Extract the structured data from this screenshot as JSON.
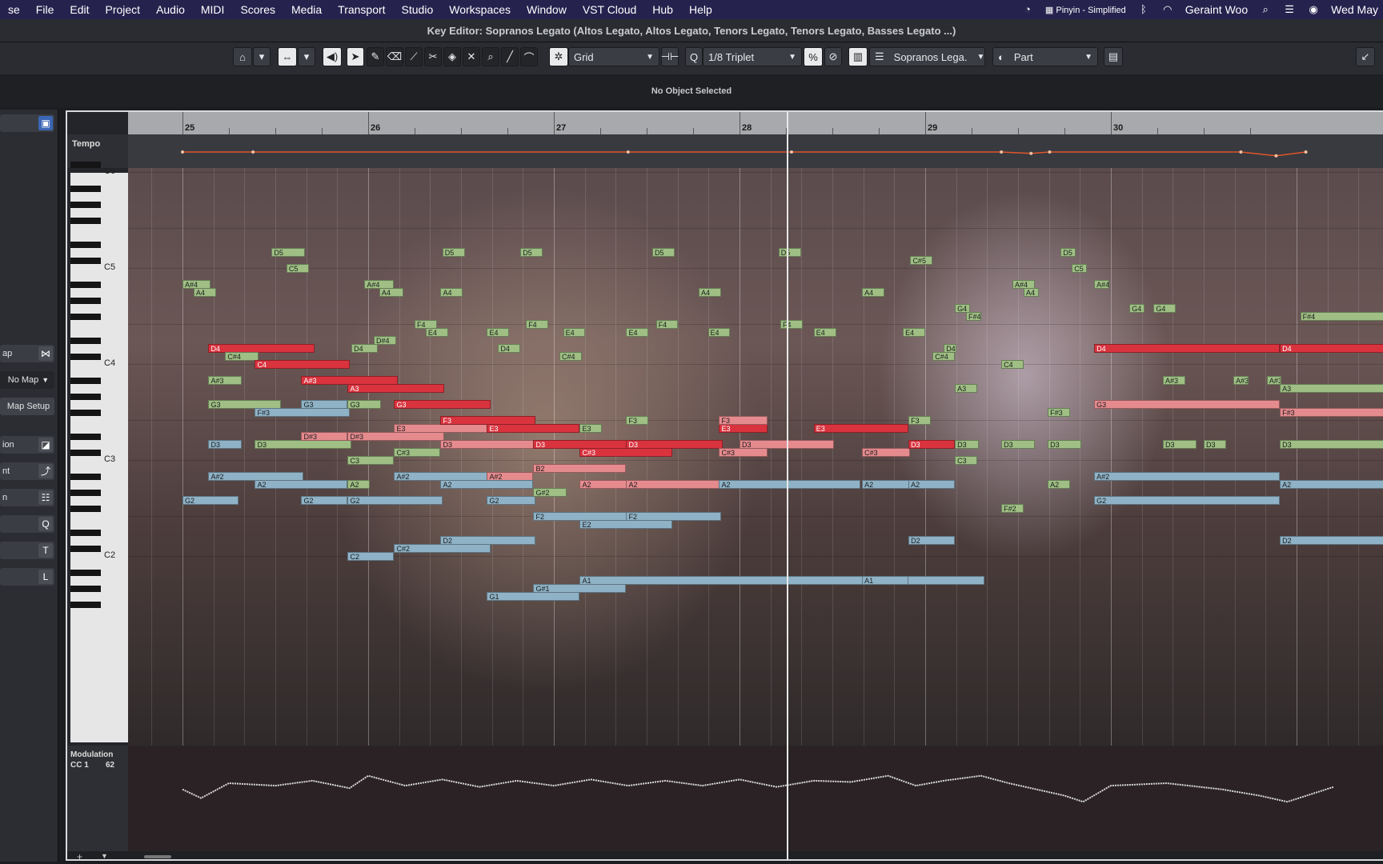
{
  "menubar": {
    "items": [
      "se",
      "File",
      "Edit",
      "Project",
      "Audio",
      "MIDI",
      "Scores",
      "Media",
      "Transport",
      "Studio",
      "Workspaces",
      "Window",
      "VST Cloud",
      "Hub",
      "Help"
    ],
    "input_method": "Pinyin - Simplified",
    "user": "Geraint Woo",
    "datetime": "Wed May"
  },
  "title": "Key Editor: Sopranos Legato (Altos Legato, Altos Legato, Tenors Legato, Tenors Legato, Basses Legato ...)",
  "toolbar": {
    "snap_type": "Grid",
    "quantize_prefix": "Q",
    "quantize": "1/8 Triplet",
    "track": "Sopranos Lega.",
    "part": "Part"
  },
  "info_line": "No Object Selected",
  "inspector": {
    "map_label": "ap",
    "no_map": "No Map",
    "map_setup": "Map Setup",
    "row1": "ion",
    "row2": "nt",
    "row3": "n"
  },
  "ruler": {
    "bars": [
      "25",
      "26",
      "27",
      "28",
      "29",
      "30"
    ]
  },
  "tempo_label": "Tempo",
  "keyboard": {
    "octave_labels": [
      "C6",
      "C5",
      "C4",
      "C3",
      "C2"
    ]
  },
  "controller_lane": {
    "name": "Modulation",
    "cc": "CC 1",
    "value": "62"
  },
  "notes": [
    {
      "p": "A#4",
      "s": 0.0,
      "l": 0.15,
      "c": "green"
    },
    {
      "p": "A4",
      "s": 0.06,
      "l": 0.12,
      "c": "green"
    },
    {
      "p": "D5",
      "s": 0.48,
      "l": 0.18,
      "c": "green"
    },
    {
      "p": "C5",
      "s": 0.56,
      "l": 0.12,
      "c": "green"
    },
    {
      "p": "D4",
      "s": 0.14,
      "l": 0.57,
      "c": "red"
    },
    {
      "p": "C#4",
      "s": 0.23,
      "l": 0.18,
      "c": "green"
    },
    {
      "p": "C4",
      "s": 0.39,
      "l": 0.51,
      "c": "red"
    },
    {
      "p": "A#3",
      "s": 0.14,
      "l": 0.18,
      "c": "green"
    },
    {
      "p": "G3",
      "s": 0.14,
      "l": 0.39,
      "c": "green"
    },
    {
      "p": "F#3",
      "s": 0.39,
      "l": 0.51,
      "c": "blue"
    },
    {
      "p": "D3",
      "s": 0.14,
      "l": 0.18,
      "c": "blue"
    },
    {
      "p": "D3",
      "s": 0.39,
      "l": 0.52,
      "c": "green"
    },
    {
      "p": "G2",
      "s": 0.0,
      "l": 0.3,
      "c": "blue"
    },
    {
      "p": "A#2",
      "s": 0.14,
      "l": 0.51,
      "c": "blue"
    },
    {
      "p": "A2",
      "s": 0.39,
      "l": 0.5,
      "c": "blue"
    },
    {
      "p": "D4",
      "s": 0.91,
      "l": 0.14,
      "c": "green"
    },
    {
      "p": "D#4",
      "s": 1.03,
      "l": 0.12,
      "c": "green"
    },
    {
      "p": "A#4",
      "s": 0.98,
      "l": 0.16,
      "c": "green"
    },
    {
      "p": "A4",
      "s": 1.06,
      "l": 0.13,
      "c": "green"
    },
    {
      "p": "F4",
      "s": 1.25,
      "l": 0.12,
      "c": "green"
    },
    {
      "p": "E4",
      "s": 1.31,
      "l": 0.12,
      "c": "green"
    },
    {
      "p": "A#3",
      "s": 0.64,
      "l": 0.52,
      "c": "red"
    },
    {
      "p": "A3",
      "s": 0.89,
      "l": 0.52,
      "c": "red"
    },
    {
      "p": "G3",
      "s": 0.64,
      "l": 0.25,
      "c": "blue"
    },
    {
      "p": "G3",
      "s": 0.89,
      "l": 0.18,
      "c": "green"
    },
    {
      "p": "D#3",
      "s": 0.64,
      "l": 0.25,
      "c": "pink"
    },
    {
      "p": "D#3",
      "s": 0.89,
      "l": 0.52,
      "c": "pink"
    },
    {
      "p": "C3",
      "s": 0.89,
      "l": 0.25,
      "c": "green"
    },
    {
      "p": "A2",
      "s": 0.89,
      "l": 0.12,
      "c": "green"
    },
    {
      "p": "G2",
      "s": 0.64,
      "l": 0.25,
      "c": "blue"
    },
    {
      "p": "G2",
      "s": 0.89,
      "l": 0.51,
      "c": "blue"
    },
    {
      "p": "C2",
      "s": 0.89,
      "l": 0.25,
      "c": "blue"
    },
    {
      "p": "C#2",
      "s": 1.14,
      "l": 0.52,
      "c": "blue"
    },
    {
      "p": "A#2",
      "s": 1.14,
      "l": 0.51,
      "c": "blue"
    },
    {
      "p": "C#3",
      "s": 1.14,
      "l": 0.25,
      "c": "green"
    },
    {
      "p": "E3",
      "s": 1.14,
      "l": 0.52,
      "c": "pink"
    },
    {
      "p": "G3",
      "s": 1.14,
      "l": 0.52,
      "c": "red"
    },
    {
      "p": "A4",
      "s": 1.39,
      "l": 0.12,
      "c": "green"
    },
    {
      "p": "D5",
      "s": 1.4,
      "l": 0.12,
      "c": "green"
    },
    {
      "p": "E4",
      "s": 1.64,
      "l": 0.12,
      "c": "green"
    },
    {
      "p": "D4",
      "s": 1.7,
      "l": 0.12,
      "c": "green"
    },
    {
      "p": "D5",
      "s": 1.82,
      "l": 0.12,
      "c": "green"
    },
    {
      "p": "F4",
      "s": 1.85,
      "l": 0.12,
      "c": "green"
    },
    {
      "p": "C#4",
      "s": 2.03,
      "l": 0.12,
      "c": "green"
    },
    {
      "p": "E4",
      "s": 2.05,
      "l": 0.12,
      "c": "green"
    },
    {
      "p": "F3",
      "s": 1.39,
      "l": 0.51,
      "c": "red"
    },
    {
      "p": "E3",
      "s": 1.64,
      "l": 0.5,
      "c": "red"
    },
    {
      "p": "D3",
      "s": 1.39,
      "l": 0.51,
      "c": "pink"
    },
    {
      "p": "D3",
      "s": 1.89,
      "l": 0.51,
      "c": "red"
    },
    {
      "p": "A#2",
      "s": 1.64,
      "l": 0.25,
      "c": "pink"
    },
    {
      "p": "A2",
      "s": 1.39,
      "l": 0.5,
      "c": "blue"
    },
    {
      "p": "G2",
      "s": 1.64,
      "l": 0.26,
      "c": "blue"
    },
    {
      "p": "G#2",
      "s": 1.89,
      "l": 0.18,
      "c": "green"
    },
    {
      "p": "B2",
      "s": 1.89,
      "l": 0.5,
      "c": "pink"
    },
    {
      "p": "F2",
      "s": 1.89,
      "l": 0.51,
      "c": "blue"
    },
    {
      "p": "D2",
      "s": 1.39,
      "l": 0.51,
      "c": "blue"
    },
    {
      "p": "G1",
      "s": 1.64,
      "l": 0.5,
      "c": "blue"
    },
    {
      "p": "G#1",
      "s": 1.89,
      "l": 0.5,
      "c": "blue"
    },
    {
      "p": "E3",
      "s": 2.14,
      "l": 0.12,
      "c": "green"
    },
    {
      "p": "C#3",
      "s": 2.14,
      "l": 0.5,
      "c": "red"
    },
    {
      "p": "A2",
      "s": 2.14,
      "l": 0.5,
      "c": "pink"
    },
    {
      "p": "E2",
      "s": 2.14,
      "l": 0.5,
      "c": "blue"
    },
    {
      "p": "A1",
      "s": 2.14,
      "l": 2.18,
      "c": "blue"
    },
    {
      "p": "F3",
      "s": 2.39,
      "l": 0.12,
      "c": "green"
    },
    {
      "p": "F2",
      "s": 2.39,
      "l": 0.51,
      "c": "blue"
    },
    {
      "p": "D3",
      "s": 2.39,
      "l": 0.52,
      "c": "red"
    },
    {
      "p": "A2",
      "s": 2.39,
      "l": 0.52,
      "c": "pink"
    },
    {
      "p": "E4",
      "s": 2.39,
      "l": 0.12,
      "c": "green"
    },
    {
      "p": "F4",
      "s": 2.55,
      "l": 0.12,
      "c": "green"
    },
    {
      "p": "D5",
      "s": 2.53,
      "l": 0.12,
      "c": "green"
    },
    {
      "p": "A4",
      "s": 2.78,
      "l": 0.12,
      "c": "green"
    },
    {
      "p": "E4",
      "s": 2.83,
      "l": 0.12,
      "c": "green"
    },
    {
      "p": "E3",
      "s": 2.89,
      "l": 0.26,
      "c": "red"
    },
    {
      "p": "C#3",
      "s": 2.89,
      "l": 0.26,
      "c": "pink"
    },
    {
      "p": "F3",
      "s": 2.89,
      "l": 0.26,
      "c": "pink"
    },
    {
      "p": "D3",
      "s": 3.0,
      "l": 0.51,
      "c": "pink"
    },
    {
      "p": "A2",
      "s": 2.89,
      "l": 0.76,
      "c": "blue"
    },
    {
      "p": "D5",
      "s": 3.21,
      "l": 0.12,
      "c": "green"
    },
    {
      "p": "F4",
      "s": 3.22,
      "l": 0.12,
      "c": "green"
    },
    {
      "p": "E4",
      "s": 3.4,
      "l": 0.12,
      "c": "green"
    },
    {
      "p": "E3",
      "s": 3.52,
      "l": 0.18,
      "c": "pink"
    },
    {
      "p": "E3",
      "s": 3.4,
      "l": 0.51,
      "c": "red"
    },
    {
      "p": "A4",
      "s": 3.66,
      "l": 0.12,
      "c": "green"
    },
    {
      "p": "C#5",
      "s": 3.92,
      "l": 0.12,
      "c": "green"
    },
    {
      "p": "E4",
      "s": 3.88,
      "l": 0.12,
      "c": "green"
    },
    {
      "p": "A2",
      "s": 3.66,
      "l": 0.26,
      "c": "blue"
    },
    {
      "p": "C#3",
      "s": 3.66,
      "l": 0.26,
      "c": "pink"
    },
    {
      "p": "A1",
      "s": 3.66,
      "l": 0.25,
      "c": "blue"
    },
    {
      "p": "F3",
      "s": 3.91,
      "l": 0.12,
      "c": "green"
    },
    {
      "p": "D3",
      "s": 3.91,
      "l": 0.25,
      "c": "red"
    },
    {
      "p": "A2",
      "s": 3.91,
      "l": 0.25,
      "c": "blue"
    },
    {
      "p": "D2",
      "s": 3.91,
      "l": 0.25,
      "c": "blue"
    },
    {
      "p": "C#4",
      "s": 4.04,
      "l": 0.12,
      "c": "green"
    },
    {
      "p": "D4",
      "s": 4.1,
      "l": 0.06,
      "c": "green"
    },
    {
      "p": "G4",
      "s": 4.16,
      "l": 0.08,
      "c": "green"
    },
    {
      "p": "F#4",
      "s": 4.22,
      "l": 0.08,
      "c": "green"
    },
    {
      "p": "A3",
      "s": 4.16,
      "l": 0.12,
      "c": "green"
    },
    {
      "p": "D3",
      "s": 4.16,
      "l": 0.13,
      "c": "green"
    },
    {
      "p": "C3",
      "s": 4.16,
      "l": 0.12,
      "c": "green"
    },
    {
      "p": "C4",
      "s": 4.41,
      "l": 0.12,
      "c": "green"
    },
    {
      "p": "D3",
      "s": 4.41,
      "l": 0.18,
      "c": "green"
    },
    {
      "p": "F#2",
      "s": 4.41,
      "l": 0.12,
      "c": "green"
    },
    {
      "p": "A#4",
      "s": 4.47,
      "l": 0.12,
      "c": "green"
    },
    {
      "p": "A4",
      "s": 4.53,
      "l": 0.08,
      "c": "green"
    },
    {
      "p": "F#3",
      "s": 4.66,
      "l": 0.12,
      "c": "green"
    },
    {
      "p": "D3",
      "s": 4.66,
      "l": 0.18,
      "c": "green"
    },
    {
      "p": "A2",
      "s": 4.66,
      "l": 0.12,
      "c": "green"
    },
    {
      "p": "D5",
      "s": 4.73,
      "l": 0.08,
      "c": "green"
    },
    {
      "p": "C5",
      "s": 4.79,
      "l": 0.08,
      "c": "green"
    },
    {
      "p": "D4",
      "s": 4.91,
      "l": 1.0,
      "c": "red"
    },
    {
      "p": "G3",
      "s": 4.91,
      "l": 1.0,
      "c": "pink"
    },
    {
      "p": "A#2",
      "s": 4.91,
      "l": 1.0,
      "c": "blue"
    },
    {
      "p": "G2",
      "s": 4.91,
      "l": 1.0,
      "c": "blue"
    },
    {
      "p": "A#4",
      "s": 4.91,
      "l": 0.08,
      "c": "green"
    },
    {
      "p": "G4",
      "s": 5.1,
      "l": 0.08,
      "c": "green"
    },
    {
      "p": "G4",
      "s": 5.23,
      "l": 0.12,
      "c": "green"
    },
    {
      "p": "A#3",
      "s": 5.28,
      "l": 0.12,
      "c": "green"
    },
    {
      "p": "D3",
      "s": 5.28,
      "l": 0.18,
      "c": "green"
    },
    {
      "p": "D3",
      "s": 5.5,
      "l": 0.12,
      "c": "green"
    },
    {
      "p": "A#3",
      "s": 5.66,
      "l": 0.08,
      "c": "green"
    },
    {
      "p": "A#3",
      "s": 5.84,
      "l": 0.08,
      "c": "green"
    },
    {
      "p": "D4",
      "s": 5.91,
      "l": 0.6,
      "c": "red"
    },
    {
      "p": "F#4",
      "s": 6.02,
      "l": 0.5,
      "c": "green"
    },
    {
      "p": "A3",
      "s": 5.91,
      "l": 0.6,
      "c": "green"
    },
    {
      "p": "F#3",
      "s": 5.91,
      "l": 0.6,
      "c": "pink"
    },
    {
      "p": "D3",
      "s": 5.91,
      "l": 0.6,
      "c": "green"
    },
    {
      "p": "A2",
      "s": 5.91,
      "l": 0.6,
      "c": "blue"
    },
    {
      "p": "D2",
      "s": 5.91,
      "l": 0.6,
      "c": "blue"
    }
  ],
  "tempo_curve": [
    [
      0,
      100
    ],
    [
      0.38,
      100
    ],
    [
      2.4,
      100
    ],
    [
      3.28,
      100
    ],
    [
      4.41,
      100
    ],
    [
      4.57,
      97
    ],
    [
      4.67,
      100
    ],
    [
      5.7,
      100
    ],
    [
      5.89,
      92
    ],
    [
      6.05,
      100
    ]
  ],
  "modulation_curve": [
    [
      0,
      55
    ],
    [
      0.1,
      48
    ],
    [
      0.25,
      60
    ],
    [
      0.5,
      58
    ],
    [
      0.7,
      62
    ],
    [
      0.9,
      56
    ],
    [
      1.0,
      66
    ],
    [
      1.2,
      58
    ],
    [
      1.4,
      63
    ],
    [
      1.6,
      57
    ],
    [
      1.8,
      62
    ],
    [
      2.0,
      58
    ],
    [
      2.2,
      63
    ],
    [
      2.4,
      58
    ],
    [
      2.6,
      62
    ],
    [
      2.8,
      58
    ],
    [
      3.0,
      63
    ],
    [
      3.2,
      57
    ],
    [
      3.4,
      62
    ],
    [
      3.6,
      61
    ],
    [
      3.8,
      66
    ],
    [
      3.95,
      58
    ],
    [
      4.1,
      62
    ],
    [
      4.3,
      66
    ],
    [
      4.45,
      60
    ],
    [
      4.6,
      55
    ],
    [
      4.75,
      50
    ],
    [
      4.85,
      45
    ],
    [
      5.0,
      58
    ],
    [
      5.3,
      60
    ],
    [
      5.6,
      55
    ],
    [
      5.8,
      50
    ],
    [
      5.95,
      45
    ],
    [
      6.2,
      57
    ]
  ],
  "colors": {
    "menubar": "#26224e",
    "note_green": "#9fbf84",
    "note_red": "#d9333e",
    "note_pink": "#e58b8e",
    "note_blue": "#8fb2c6",
    "tempo_line": "#e0552a",
    "mod_line": "#d9d9d9"
  }
}
